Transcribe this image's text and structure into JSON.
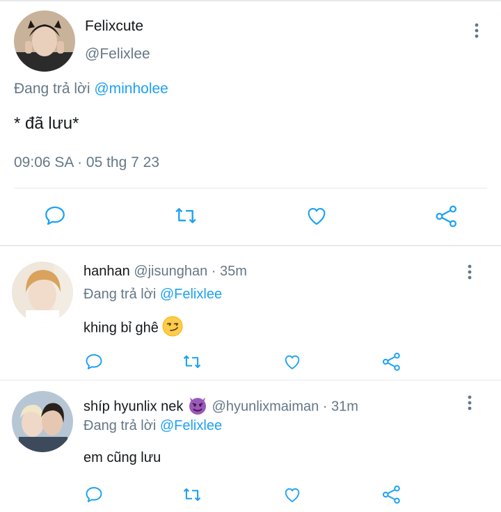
{
  "main_tweet": {
    "display_name": "Felixcute",
    "handle": "@Felixlee",
    "reply_prefix": "Đang trả lời",
    "reply_mention": "@minholee",
    "text": "* đã lưu*",
    "timestamp": "09:06 SA · 05 thg 7 23"
  },
  "replies": [
    {
      "display_name": "hanhan",
      "meta": "@jisunghan · 35m",
      "reply_prefix": "Đang trả lời",
      "reply_mention": "@Felixlee",
      "text": "khing bỉ ghê",
      "emoji": "smirk-emoji"
    },
    {
      "display_name": "shíp hyunlix nek",
      "meta": "@hyunlixmaiman · 31m",
      "reply_prefix": "Đang trả lời",
      "reply_mention": "@Felixlee",
      "text": "em cũng lưu",
      "emoji": "smiling-devil-emoji"
    }
  ],
  "icons": {
    "reply": "reply-icon",
    "retweet": "retweet-icon",
    "like": "heart-icon",
    "share": "share-icon",
    "more": "more-vertical-icon"
  },
  "colors": {
    "link": "#1da1f2",
    "secondary_text": "#657786",
    "icon": "#1da1f2",
    "divider": "#e6e9ec"
  }
}
